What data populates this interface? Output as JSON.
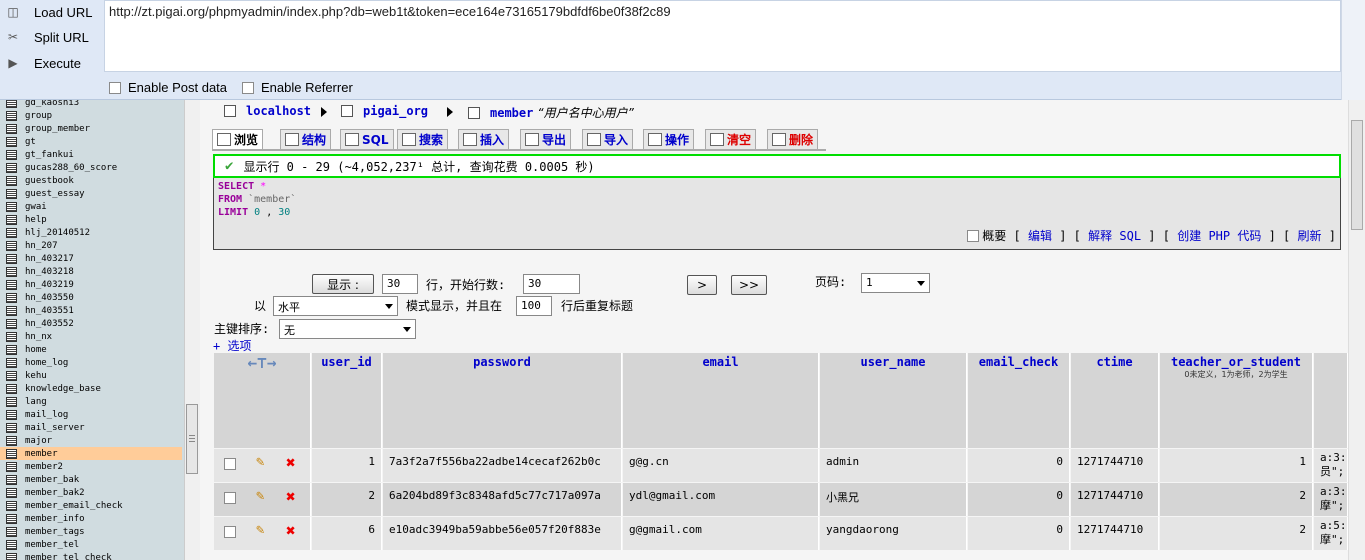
{
  "hackbar": {
    "load_label": "Load URL",
    "split_label": "Split URL",
    "execute_label": "Execute",
    "url": "http://zt.pigai.org/phpmyadmin/index.php?db=web1t&token=ece164e73165179bdfdf6be0f38f2c89",
    "post_label": "Enable Post data",
    "referrer_label": "Enable Referrer"
  },
  "sidebar": {
    "tables": [
      "gd_kaoshi3",
      "group",
      "group_member",
      "gt",
      "gt_fankui",
      "gucas288_60_score",
      "guestbook",
      "guest_essay",
      "gwai",
      "help",
      "hlj_20140512",
      "hn_207",
      "hn_403217",
      "hn_403218",
      "hn_403219",
      "hn_403550",
      "hn_403551",
      "hn_403552",
      "hn_nx",
      "home",
      "home_log",
      "kehu",
      "knowledge_base",
      "lang",
      "mail_log",
      "mail_server",
      "major",
      "member",
      "member2",
      "member_bak",
      "member_bak2",
      "member_email_check",
      "member_info",
      "member_tags",
      "member_tel",
      "member_tel_check"
    ],
    "active": "member"
  },
  "breadcrumb": {
    "server": "localhost",
    "db": "pigai_org",
    "table": "member",
    "comment": "“用户名中心用户”"
  },
  "tabs": [
    {
      "label": "浏览"
    },
    {
      "label": "结构"
    },
    {
      "label": "SQL"
    },
    {
      "label": "搜索"
    },
    {
      "label": "插入"
    },
    {
      "label": "导出"
    },
    {
      "label": "导入"
    },
    {
      "label": "操作"
    },
    {
      "label": "清空"
    },
    {
      "label": "删除"
    }
  ],
  "notice": "显示行 0 - 29 (~4,052,237¹ 总计, 查询花费 0.0005 秒)",
  "sql": {
    "select": "SELECT",
    "star": "*",
    "from": "FROM",
    "table": "`member`",
    "limit": "LIMIT",
    "offset": "0",
    "comma": ",",
    "count": "30"
  },
  "sql_tools": {
    "profile": "概要",
    "edit": "编辑",
    "explain": "解释 SQL",
    "php": "创建 PHP 代码",
    "refresh": "刷新",
    "open": "[",
    "close": "]"
  },
  "nav": {
    "show_button": "显示 :",
    "rows": "30",
    "start_label": "行，开始行数:",
    "start": "30",
    "next": ">",
    "last": ">>",
    "page_label": "页码:",
    "page": "1",
    "mode_prefix": "以",
    "mode": "水平",
    "mode_label": "模式显示，并且在",
    "repeat": "100",
    "repeat_label": "行后重复标题",
    "sort_label": "主键排序:",
    "sort": "无",
    "options": "+ 选项"
  },
  "columns": [
    {
      "name": "user_id"
    },
    {
      "name": "password"
    },
    {
      "name": "email"
    },
    {
      "name": "user_name"
    },
    {
      "name": "email_check"
    },
    {
      "name": "ctime"
    },
    {
      "name": "teacher_or_student",
      "comment": "0未定义，1为老师，2为学生"
    }
  ],
  "rows": [
    {
      "user_id": "1",
      "password": "7a3f2a7f556ba22adbe14cecaf262b0c",
      "email": "g@g.cn",
      "user_name": "admin",
      "email_check": "0",
      "ctime": "1271744710",
      "teacher_or_student": "1",
      "extra": "a:3:",
      "extra2": "员\";"
    },
    {
      "user_id": "2",
      "password": "6a204bd89f3c8348afd5c77c717a097a",
      "email": "ydl@gmail.com",
      "user_name": "小黑兄",
      "email_check": "0",
      "ctime": "1271744710",
      "teacher_or_student": "2",
      "extra": "a:3:",
      "extra2": "摩\";"
    },
    {
      "user_id": "6",
      "password": "e10adc3949ba59abbe56e057f20f883e",
      "email": "g@gmail.com",
      "user_name": "yangdaorong",
      "email_check": "0",
      "ctime": "1271744710",
      "teacher_or_student": "2",
      "extra": "a:5:",
      "extra2": "摩\";"
    }
  ],
  "colors": {
    "notice_border": "#00dd00",
    "active_table": "#ffcc99",
    "link": "#0000cc"
  }
}
